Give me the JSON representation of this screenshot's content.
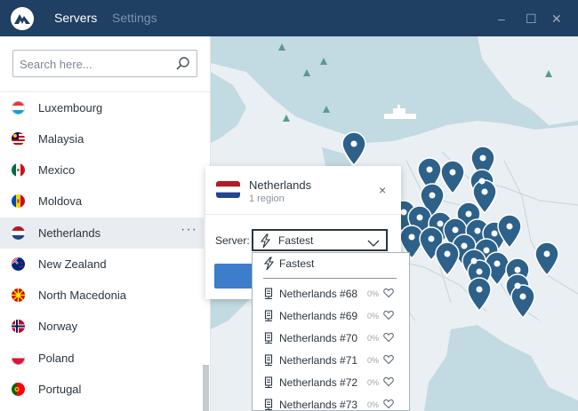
{
  "nav": {
    "tabs": [
      {
        "label": "Servers"
      },
      {
        "label": "Settings"
      }
    ],
    "window_controls": {
      "minimize": "–",
      "maximize": "☐",
      "close": "✕"
    }
  },
  "sidebar": {
    "search": {
      "placeholder": "Search here...",
      "icon": "search-icon"
    },
    "countries": [
      {
        "name": "Luxembourg",
        "flag_colors": [
          "#ef3340",
          "#ffffff",
          "#00a3e0"
        ]
      },
      {
        "name": "Malaysia",
        "flag_colors": [
          "#cc0001",
          "#ffffff",
          "#010066"
        ]
      },
      {
        "name": "Mexico",
        "flag_colors": [
          "#006847",
          "#ffffff",
          "#ce1126"
        ]
      },
      {
        "name": "Moldova",
        "flag_colors": [
          "#0046ae",
          "#ffd200",
          "#cc092f"
        ]
      },
      {
        "name": "Netherlands",
        "flag_colors": [
          "#ae1c28",
          "#ffffff",
          "#21468b"
        ],
        "selected": true,
        "more": "···"
      },
      {
        "name": "New Zealand",
        "flag_colors": [
          "#00247d",
          "#cc142b",
          "#ffffff"
        ]
      },
      {
        "name": "North Macedonia",
        "flag_colors": [
          "#d20000",
          "#ffe600"
        ]
      },
      {
        "name": "Norway",
        "flag_colors": [
          "#ba0c2f",
          "#ffffff",
          "#00205b"
        ]
      },
      {
        "name": "Poland",
        "flag_colors": [
          "#ffffff",
          "#dc143c"
        ]
      },
      {
        "name": "Portugal",
        "flag_colors": [
          "#006600",
          "#ff0000",
          "#ffcc00"
        ]
      }
    ]
  },
  "popup": {
    "country": "Netherlands",
    "regions": "1 region",
    "close": "×",
    "server_label": "Server:",
    "selected_server": "Fastest"
  },
  "dropdown": {
    "fastest_label": "Fastest",
    "servers": [
      {
        "name": "Netherlands #68",
        "load": "0%"
      },
      {
        "name": "Netherlands #69",
        "load": "0%"
      },
      {
        "name": "Netherlands #70",
        "load": "0%"
      },
      {
        "name": "Netherlands #71",
        "load": "0%"
      },
      {
        "name": "Netherlands #72",
        "load": "0%"
      },
      {
        "name": "Netherlands #73",
        "load": "0%"
      }
    ]
  },
  "colors": {
    "topbar": "#1f3f63",
    "sea": "#c2dae1",
    "land": "#e9eff2",
    "pin": "#2d6189",
    "accent": "#3d7dca"
  }
}
